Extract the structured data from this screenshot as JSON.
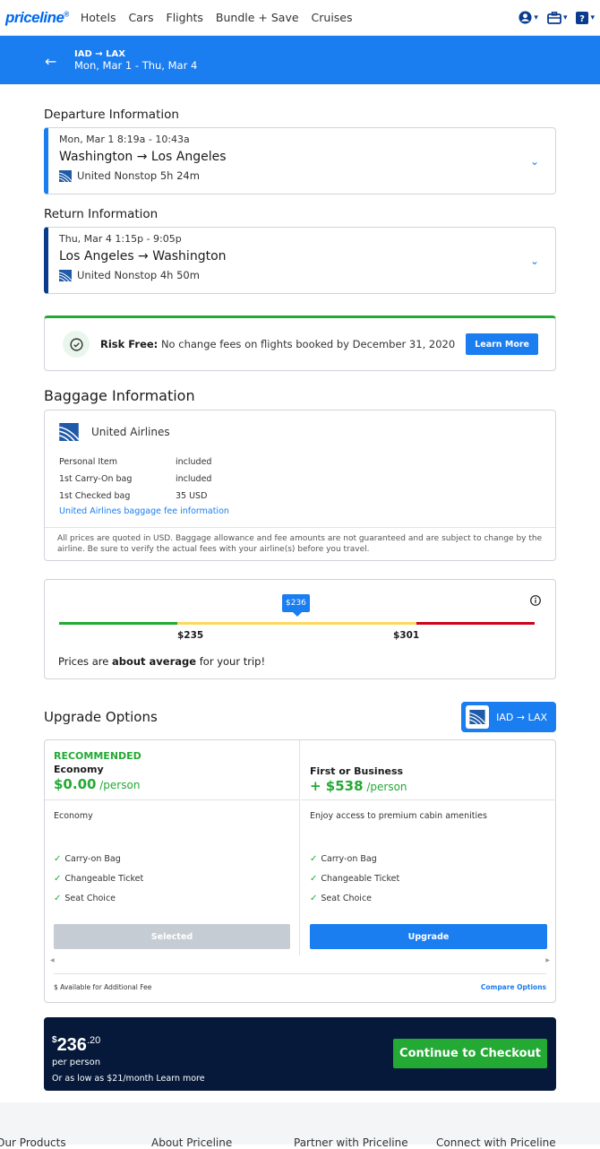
{
  "nav": {
    "logo": "priceline",
    "logo_mark": "®",
    "links": [
      "Hotels",
      "Cars",
      "Flights",
      "Bundle + Save",
      "Cruises"
    ],
    "icons": [
      "account-icon",
      "trips-icon",
      "help-icon"
    ]
  },
  "banner": {
    "route": "IAD → LAX",
    "dates": "Mon, Mar 1 - Thu, Mar 4"
  },
  "departure": {
    "heading": "Departure Information",
    "datetime": "Mon, Mar 1   8:19a - 10:43a",
    "cities": "Washington  →  Los Angeles",
    "details": "United  Nonstop  5h 24m"
  },
  "return": {
    "heading": "Return Information",
    "datetime": "Thu, Mar 4   1:15p - 9:05p",
    "cities": "Los Angeles  →  Washington",
    "details": "United  Nonstop  4h 50m"
  },
  "risk": {
    "bold": "Risk Free:",
    "text": " No change fees on flights booked by December 31, 2020",
    "button": "Learn More"
  },
  "baggage": {
    "heading": "Baggage Information",
    "airline": "United Airlines",
    "rows": [
      {
        "item": "Personal Item",
        "fee": "included"
      },
      {
        "item": "1st Carry-On bag",
        "fee": "included"
      },
      {
        "item": "1st Checked bag",
        "fee": "35 USD"
      }
    ],
    "link": "United Airlines baggage fee information",
    "disclaimer": "All prices are quoted in USD. Baggage allowance and fee amounts are not guaranteed and are subject to change by the airline. Be sure to verify the actual fees with your airline(s) before you travel."
  },
  "price_meter": {
    "current": "$236",
    "low": "$235",
    "high": "$301",
    "msg_pre": "Prices are ",
    "msg_bold": "about average",
    "msg_post": " for your trip!",
    "colors": {
      "low": "#23a934",
      "mid": "#fdd85d",
      "high": "#d0021b"
    }
  },
  "upgrade": {
    "heading": "Upgrade Options",
    "route_button": "IAD → LAX",
    "options": [
      {
        "badge": "RECOMMENDED",
        "name": "Economy",
        "prefix": "",
        "price": "$0.00",
        "unit": " /person",
        "desc": "Economy",
        "features": [
          "Carry-on Bag",
          "Changeable Ticket",
          "Seat Choice"
        ],
        "button": "Selected"
      },
      {
        "badge": "",
        "name": "First or Business",
        "prefix": "+ ",
        "price": "$538",
        "unit": " /person",
        "desc": "Enjoy access to premium cabin amenities",
        "features": [
          "Carry-on Bag",
          "Changeable Ticket",
          "Seat Choice"
        ],
        "button": "Upgrade"
      }
    ],
    "fee_note": "$ Available for Additional Fee",
    "compare": "Compare Options"
  },
  "checkout": {
    "currency": "$",
    "dollars": "236",
    "cents": ".20",
    "per": "per person",
    "low": "Or as low as $21/month  Learn more",
    "button": "Continue to Checkout"
  },
  "footer": {
    "links": [
      "Our Products",
      "About Priceline",
      "Partner with Priceline",
      "Connect with Priceline"
    ]
  }
}
